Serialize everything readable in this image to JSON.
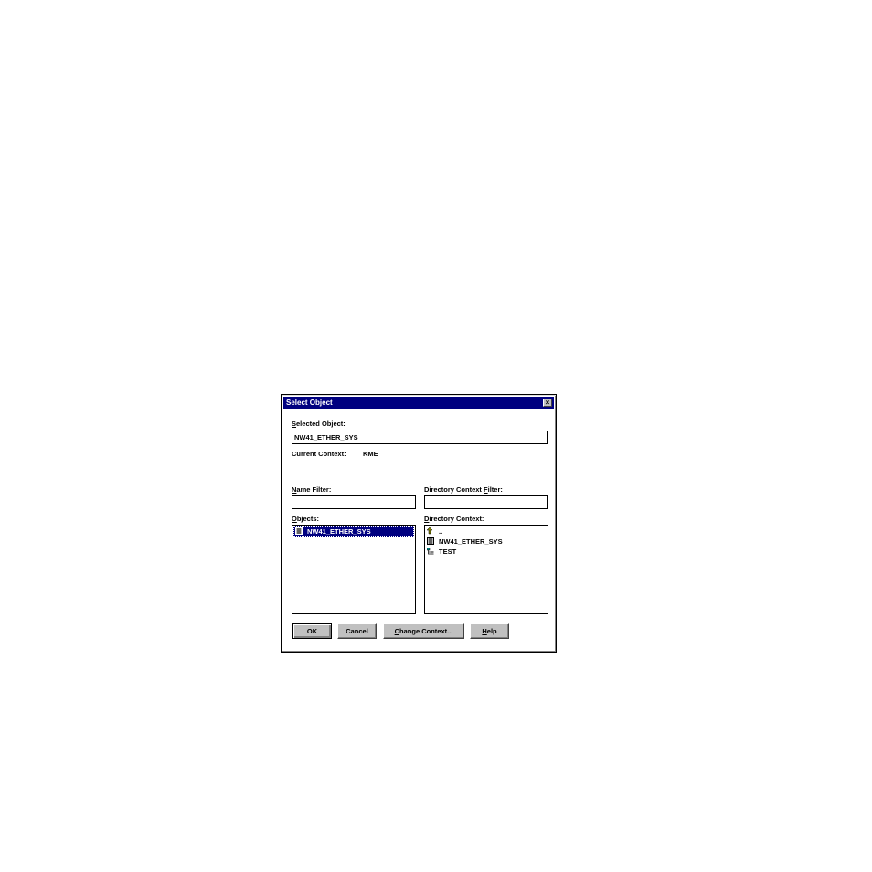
{
  "dialog": {
    "title": "Select Object",
    "close_glyph": "×"
  },
  "selected_object": {
    "label_pre": "",
    "label_key": "S",
    "label_post": "elected Object:",
    "value": "NW41_ETHER_SYS"
  },
  "current_context": {
    "label": "Current Context:",
    "value": "KME"
  },
  "name_filter": {
    "label_pre": "",
    "label_key": "N",
    "label_post": "ame Filter:",
    "value": ""
  },
  "directory_context_filter": {
    "label_pre": "Directory Context ",
    "label_key": "F",
    "label_post": "ilter:",
    "value": ""
  },
  "objects": {
    "label_pre": "",
    "label_key": "O",
    "label_post": "bjects:",
    "items": [
      {
        "text": "NW41_ETHER_SYS",
        "icon": "server-icon",
        "selected": true
      }
    ]
  },
  "directory_context": {
    "label_pre": "",
    "label_key": "D",
    "label_post": "irectory Context:",
    "items": [
      {
        "text": "..",
        "icon": "up-level-icon"
      },
      {
        "text": "NW41_ETHER_SYS",
        "icon": "server-icon"
      },
      {
        "text": "TEST",
        "icon": "organization-icon"
      }
    ]
  },
  "buttons": {
    "ok": "OK",
    "cancel": "Cancel",
    "change_context_key": "C",
    "change_context_post": "hange Context...",
    "help_key": "H",
    "help_post": "elp"
  },
  "colors": {
    "titlebar": "#000080",
    "selection": "#000080",
    "button_face": "#c0c0c0"
  }
}
